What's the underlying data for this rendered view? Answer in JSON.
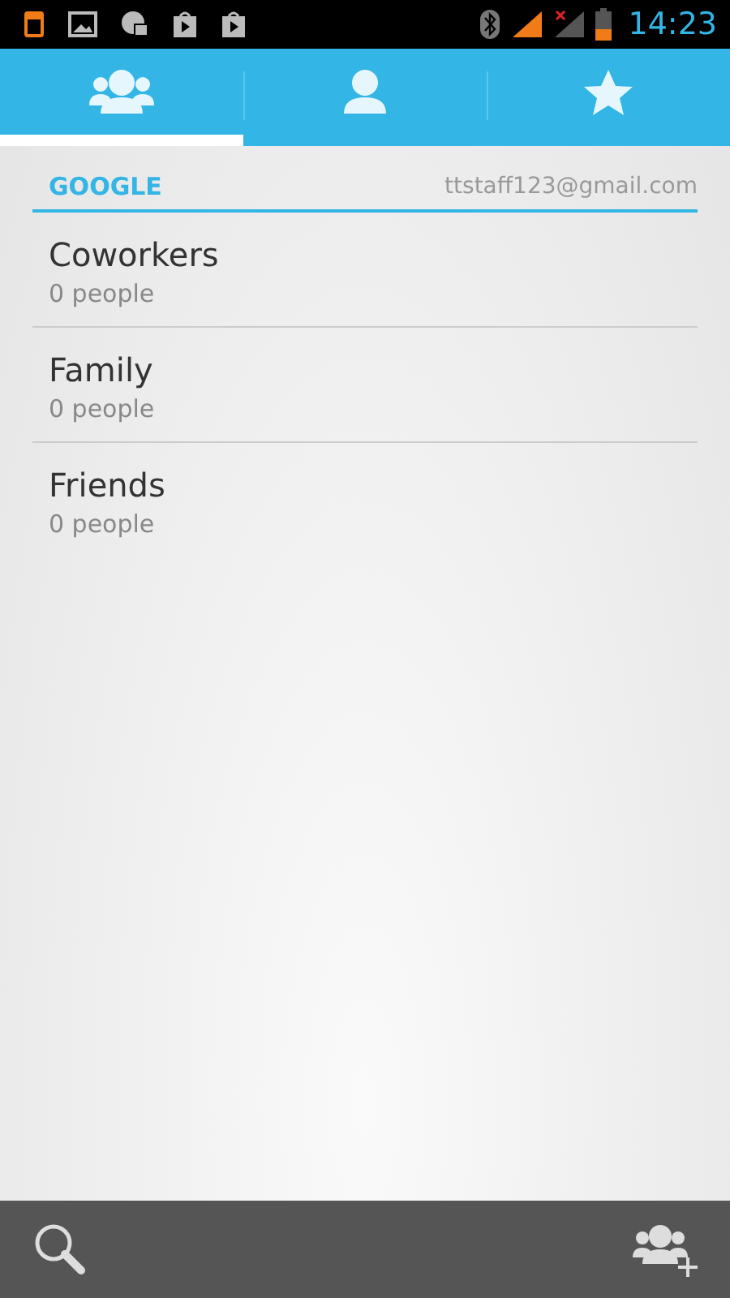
{
  "status_bar": {
    "time": "14:23"
  },
  "tabs": [
    {
      "kind": "groups",
      "selected": true
    },
    {
      "kind": "person",
      "selected": false
    },
    {
      "kind": "star",
      "selected": false
    }
  ],
  "account": {
    "type": "GOOGLE",
    "email": "ttstaff123@gmail.com"
  },
  "groups": [
    {
      "name": "Coworkers",
      "count": "0 people"
    },
    {
      "name": "Family",
      "count": "0 people"
    },
    {
      "name": "Friends",
      "count": "0 people"
    }
  ]
}
